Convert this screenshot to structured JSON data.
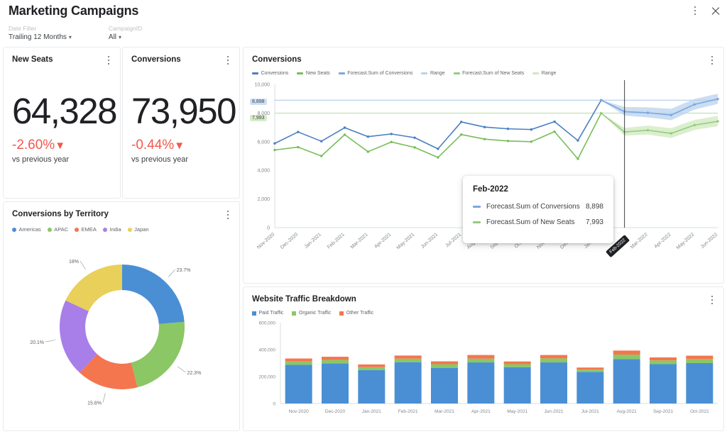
{
  "header": {
    "title": "Marketing Campaigns",
    "filters": [
      {
        "label": "Date Filter",
        "value": "Trailing 12 Months",
        "caret": "⌄"
      },
      {
        "label": "CampaignID",
        "value": "All",
        "caret": "⌄"
      }
    ],
    "menu_icon": "kebab-menu-icon",
    "close_icon": "close-icon"
  },
  "kpis": [
    {
      "title": "New Seats",
      "value": "64,328",
      "delta": "-2.60%",
      "delta_arrow": "▼",
      "delta_color": "#f2584d",
      "subtitle": "vs previous year"
    },
    {
      "title": "Conversions",
      "value": "73,950",
      "delta": "-0.44%",
      "delta_arrow": "▼",
      "delta_color": "#f2584d",
      "subtitle": "vs previous year"
    }
  ],
  "donut_card": {
    "title": "Conversions by Territory"
  },
  "line_card": {
    "title": "Conversions"
  },
  "bar_card": {
    "title": "Website Traffic Breakdown"
  },
  "tooltip": {
    "title": "Feb-2022",
    "rows": [
      {
        "name": "Forecast.Sum of Conversions",
        "value": "8,898",
        "color": "#7aa7e0"
      },
      {
        "name": "Forecast.Sum of New Seats",
        "value": "7,993",
        "color": "#93cc7e"
      }
    ]
  },
  "value_badges": [
    {
      "text": "8,898",
      "color": "#cfe0f5"
    },
    {
      "text": "7,993",
      "color": "#d6ecc8"
    }
  ],
  "chart_data": [
    {
      "type": "pie",
      "title": "Conversions by Territory",
      "legend_position": "top-left",
      "categories": [
        "Americas",
        "APAC",
        "EMEA",
        "India",
        "Japan"
      ],
      "values": [
        23.7,
        22.3,
        15.8,
        20.1,
        18.0
      ],
      "labels": [
        "23.7%",
        "22.3%",
        "15.8%",
        "20.1%",
        "18%"
      ],
      "colors": [
        "#4a8fd4",
        "#8bc765",
        "#f4764e",
        "#a87ee8",
        "#e8d05a"
      ]
    },
    {
      "type": "line",
      "title": "Conversions",
      "xlabel": "",
      "ylabel": "",
      "ylim": [
        0,
        10000
      ],
      "yticks": [
        0,
        2000,
        4000,
        6000,
        8000,
        10000
      ],
      "ytick_labels": [
        "0",
        "2,000",
        "4,000",
        "6,000",
        "8,000",
        "10,000"
      ],
      "grid": false,
      "legend_position": "top",
      "x": [
        "Nov-2020",
        "Dec-2020",
        "Jan-2021",
        "Feb-2021",
        "Mar-2021",
        "Apr-2021",
        "May-2021",
        "Jun-2021",
        "Jul-2021",
        "Aug-2021",
        "Sep-2021",
        "Oct-2021",
        "Nov-2021",
        "Dec-2021",
        "Jan-2022",
        "Feb-2022",
        "Mar-2022",
        "Apr-2022",
        "May-2022",
        "Jun-2022"
      ],
      "cursor_x": "Feb-2022",
      "reference_lines": [
        {
          "value": 8898,
          "color": "#a8c4e8"
        },
        {
          "value": 7993,
          "color": "#bcdca6"
        }
      ],
      "series": [
        {
          "name": "Conversions",
          "color": "#4a7fc1",
          "values": [
            5880,
            6680,
            6030,
            6980,
            6350,
            6540,
            6280,
            5500,
            7380,
            7020,
            6900,
            6850,
            7400,
            6080,
            8898,
            null,
            null,
            null,
            null,
            null
          ]
        },
        {
          "name": "New Seats",
          "color": "#78bd5a",
          "values": [
            5420,
            5620,
            5000,
            6490,
            5300,
            5980,
            5600,
            4900,
            6500,
            6180,
            6050,
            6000,
            6700,
            4800,
            7993,
            null,
            null,
            null,
            null,
            null
          ]
        },
        {
          "name": "Forecast.Sum of Conversions",
          "color": "#7aa7e0",
          "values": [
            null,
            null,
            null,
            null,
            null,
            null,
            null,
            null,
            null,
            null,
            null,
            null,
            null,
            null,
            8898,
            8100,
            8020,
            7860,
            8600,
            8980
          ]
        },
        {
          "name": "Range",
          "color": "#b9d1ee",
          "band_for": "Forecast.Sum of Conversions",
          "upper": [
            null,
            null,
            null,
            null,
            null,
            null,
            null,
            null,
            null,
            null,
            null,
            null,
            null,
            null,
            8898,
            8420,
            8400,
            8300,
            8980,
            9350
          ],
          "lower": [
            null,
            null,
            null,
            null,
            null,
            null,
            null,
            null,
            null,
            null,
            null,
            null,
            null,
            null,
            8898,
            7820,
            7700,
            7500,
            8240,
            8640
          ]
        },
        {
          "name": "Forecast.Sum of New Seats",
          "color": "#93cc7e",
          "values": [
            null,
            null,
            null,
            null,
            null,
            null,
            null,
            null,
            null,
            null,
            null,
            null,
            null,
            null,
            7993,
            6680,
            6800,
            6580,
            7160,
            7420
          ]
        },
        {
          "name": "Range",
          "color": "#cfe8bd",
          "band_for": "Forecast.Sum of New Seats",
          "upper": [
            null,
            null,
            null,
            null,
            null,
            null,
            null,
            null,
            null,
            null,
            null,
            null,
            null,
            null,
            7993,
            6960,
            7120,
            6940,
            7520,
            7800
          ],
          "lower": [
            null,
            null,
            null,
            null,
            null,
            null,
            null,
            null,
            null,
            null,
            null,
            null,
            null,
            null,
            7993,
            6420,
            6500,
            6260,
            6820,
            7080
          ]
        }
      ]
    },
    {
      "type": "bar",
      "title": "Website Traffic Breakdown",
      "stacked": true,
      "xlabel": "",
      "ylabel": "",
      "ylim": [
        0,
        600000
      ],
      "yticks": [
        0,
        200000,
        400000,
        600000
      ],
      "ytick_labels": [
        "0",
        "200,000",
        "400,000",
        "600,000"
      ],
      "legend_position": "top",
      "categories": [
        "Nov-2020",
        "Dec-2020",
        "Jan-2021",
        "Feb-2021",
        "Mar-2021",
        "Apr-2021",
        "May-2021",
        "Jun-2021",
        "Jul-2021",
        "Aug-2021",
        "Sep-2021",
        "Oct-2021"
      ],
      "series": [
        {
          "name": "Paid Traffic",
          "color": "#4a8fd4",
          "values": [
            288000,
            297000,
            248000,
            307000,
            265000,
            305000,
            270000,
            305000,
            235000,
            330000,
            292000,
            300000
          ]
        },
        {
          "name": "Organic Traffic",
          "color": "#8bc765",
          "values": [
            24000,
            26000,
            22000,
            26000,
            27000,
            28000,
            22000,
            30000,
            17000,
            33000,
            28000,
            30000
          ]
        },
        {
          "name": "Other Traffic",
          "color": "#f4764e",
          "values": [
            22000,
            24000,
            20000,
            23000,
            21000,
            27000,
            20000,
            25000,
            15000,
            30000,
            22000,
            25000
          ]
        }
      ]
    }
  ]
}
